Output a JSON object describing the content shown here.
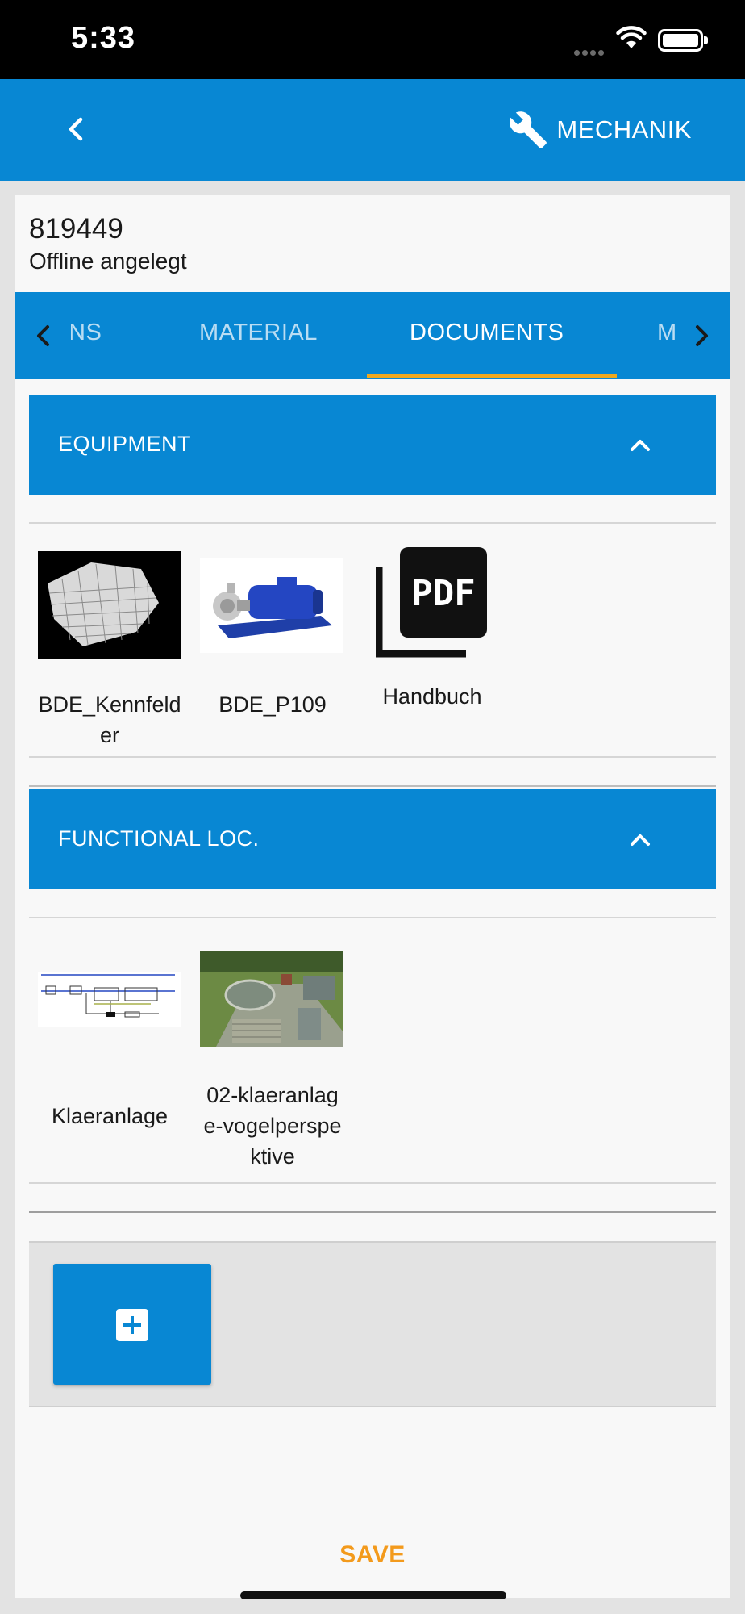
{
  "status_bar": {
    "time": "5:33"
  },
  "header": {
    "back_icon": "chevron-left-icon",
    "role_icon": "wrench-icon",
    "role_label": "MECHANIK"
  },
  "order": {
    "id": "819449",
    "status": "Offline angelegt"
  },
  "tabs": {
    "items": [
      {
        "label": "ONS"
      },
      {
        "label": "MATERIAL"
      },
      {
        "label": "DOCUMENTS",
        "active": true
      },
      {
        "label": "MEASURES"
      }
    ],
    "accent_color": "#f0a81e"
  },
  "sections": [
    {
      "title": "EQUIPMENT",
      "documents": [
        {
          "label_lines": [
            "BDE_Kennfeld",
            "er"
          ],
          "thumb": "surface-plot-image"
        },
        {
          "label_lines": [
            "BDE_P109"
          ],
          "thumb": "pump-image"
        },
        {
          "label_lines": [
            "Handbuch"
          ],
          "thumb": "pdf-icon",
          "thumb_text": "PDF"
        }
      ]
    },
    {
      "title": "FUNCTIONAL LOC.",
      "documents": [
        {
          "label_lines": [
            "Klaeranlage"
          ],
          "thumb": "process-diagram-image"
        },
        {
          "label_lines": [
            "02-klaeranlag",
            "e-vogelperspe",
            "ktive"
          ],
          "thumb": "aerial-photo-image"
        }
      ]
    }
  ],
  "add_button_icon": "plus-icon",
  "save_label": "SAVE",
  "colors": {
    "primary": "#0887d3",
    "save": "#f39a1c",
    "background": "#f8f8f8"
  }
}
